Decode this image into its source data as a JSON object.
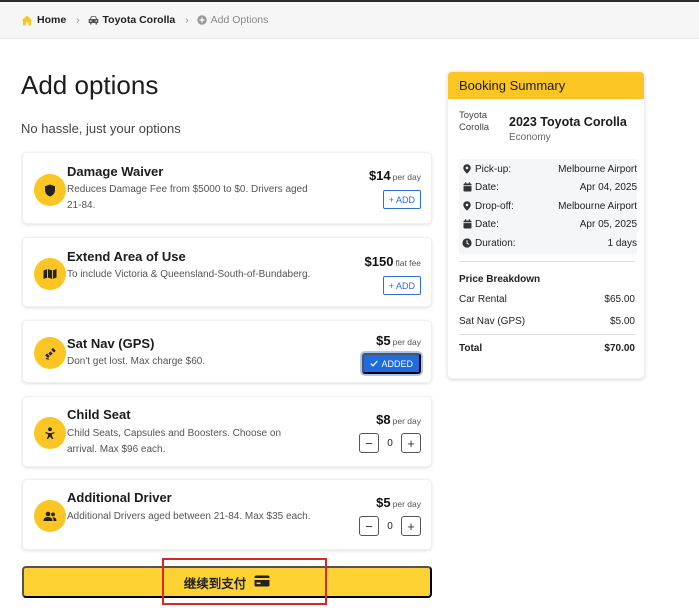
{
  "breadcrumb": {
    "home": "Home",
    "car": "Toyota Corolla",
    "current": "Add Options"
  },
  "page": {
    "title": "Add options",
    "subtitle": "No hassle, just your options"
  },
  "options": [
    {
      "title": "Damage Waiver",
      "description": "Reduces Damage Fee from $5000 to $0. Drivers aged 21-84.",
      "price": "$14",
      "unit": "per day",
      "control": "add",
      "control_label": "ADD",
      "icon": "shield-icon"
    },
    {
      "title": "Extend Area of Use",
      "description": "To include Victoria & Queensland-South-of-Bundaberg.",
      "price": "$150",
      "unit": "flat fee",
      "control": "add",
      "control_label": "ADD",
      "icon": "map-icon"
    },
    {
      "title": "Sat Nav (GPS)",
      "description": "Don't get lost. Max charge $60.",
      "price": "$5",
      "unit": "per day",
      "control": "added",
      "control_label": "ADDED",
      "icon": "satellite-icon"
    },
    {
      "title": "Child Seat",
      "description": "Child Seats, Capsules and Boosters. Choose on arrival. Max $96 each.",
      "price": "$8",
      "unit": "per day",
      "control": "stepper",
      "quantity": "0",
      "icon": "child-icon"
    },
    {
      "title": "Additional Driver",
      "description": "Additional Drivers aged between 21-84. Max $35 each.",
      "price": "$5",
      "unit": "per day",
      "control": "stepper",
      "quantity": "0",
      "icon": "users-icon"
    }
  ],
  "pay_button": {
    "label": "继续到支付",
    "icon": "credit-card-icon"
  },
  "summary": {
    "title": "Booking Summary",
    "car_image_alt": "Toyota Corolla",
    "car_name": "2023 Toyota Corolla",
    "car_class": "Economy",
    "trip": [
      {
        "icon": "map-pin-icon",
        "label": "Pick-up:",
        "value": "Melbourne Airport"
      },
      {
        "icon": "calendar-icon",
        "label": "Date:",
        "value": "Apr 04, 2025"
      },
      {
        "icon": "map-pin-icon",
        "label": "Drop-off:",
        "value": "Melbourne Airport"
      },
      {
        "icon": "calendar-icon",
        "label": "Date:",
        "value": "Apr 05, 2025"
      },
      {
        "icon": "clock-icon",
        "label": "Duration:",
        "value": "1 days"
      }
    ],
    "price_breakdown_title": "Price Breakdown",
    "prices": [
      {
        "label": "Car Rental",
        "value": "$65.00"
      },
      {
        "label": "Sat Nav (GPS)",
        "value": "$5.00"
      }
    ],
    "total": {
      "label": "Total",
      "value": "$70.00"
    }
  },
  "colors": {
    "accent": "#fbc524",
    "button_yellow": "#ffd233",
    "link_blue": "#2d6fd6",
    "added_blue": "#1f6be0",
    "highlight_red": "#d62828"
  }
}
